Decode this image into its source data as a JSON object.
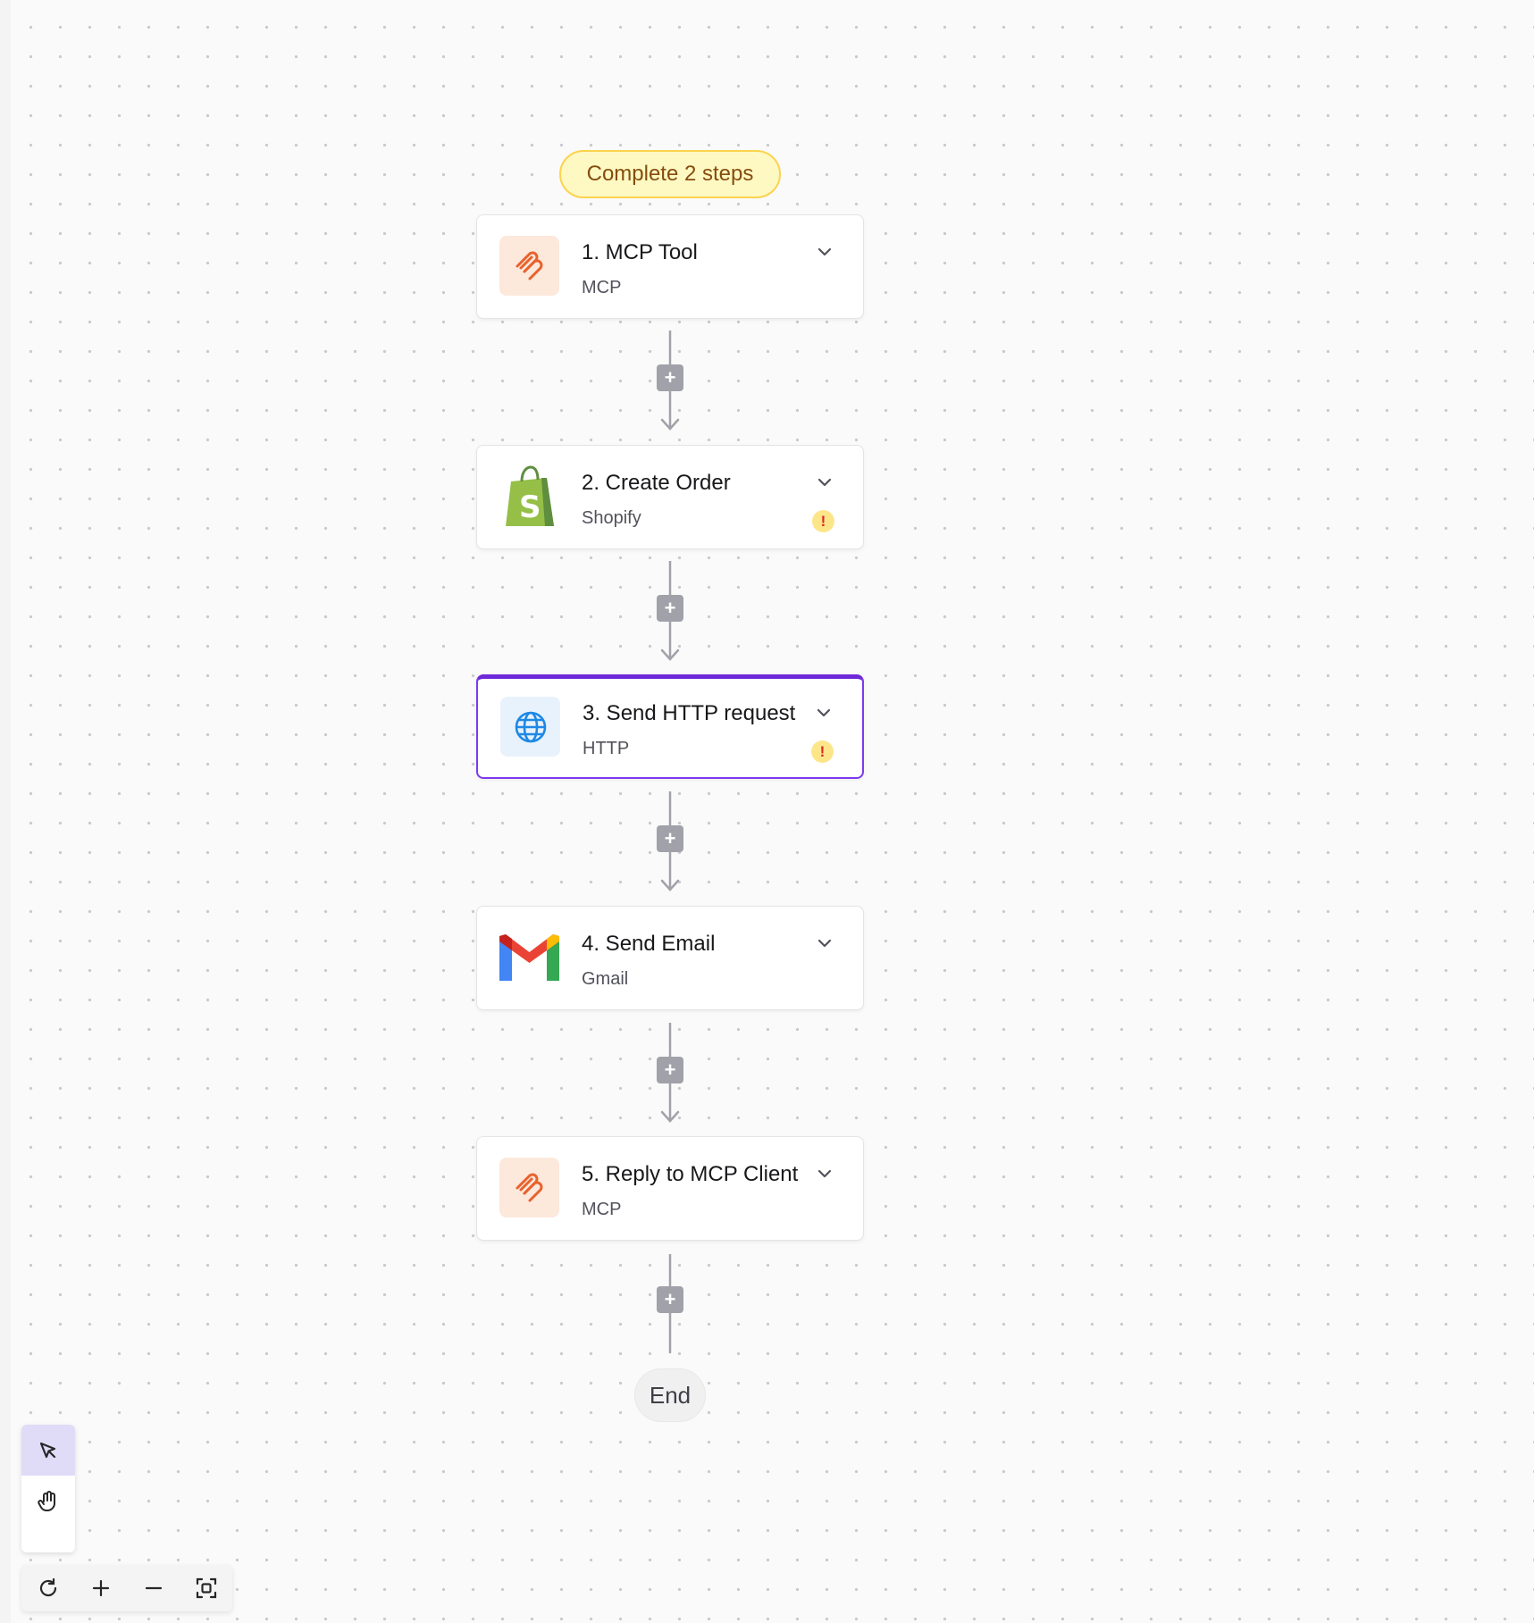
{
  "banner": {
    "label": "Complete 2 steps"
  },
  "steps": [
    {
      "title": "1. MCP Tool",
      "app": "MCP",
      "icon": "mcp-icon",
      "warning": false,
      "selected": false
    },
    {
      "title": "2. Create Order",
      "app": "Shopify",
      "icon": "shopify-icon",
      "warning": true,
      "selected": false
    },
    {
      "title": "3. Send HTTP request",
      "app": "HTTP",
      "icon": "globe-icon",
      "warning": true,
      "selected": true
    },
    {
      "title": "4. Send Email",
      "app": "Gmail",
      "icon": "gmail-icon",
      "warning": false,
      "selected": false
    },
    {
      "title": "5. Reply to MCP Client",
      "app": "MCP",
      "icon": "mcp-icon",
      "warning": false,
      "selected": false
    }
  ],
  "warning_glyph": "!",
  "add_glyph": "+",
  "end": {
    "label": "End"
  },
  "tools": [
    {
      "name": "select-pointer-icon",
      "active": true
    },
    {
      "name": "hand-pan-icon",
      "active": false
    }
  ],
  "zoom_controls": [
    "reset-icon",
    "zoom-in-icon",
    "zoom-out-icon",
    "fit-view-icon"
  ],
  "colors": {
    "accent": "#6d28d9",
    "banner_bg": "#fef9c3",
    "banner_text": "#854d0e",
    "warning_bg": "#fde68a",
    "warning_fg": "#dc2626",
    "mcp_orange": "#e8622c",
    "http_blue": "#1e88e5"
  }
}
